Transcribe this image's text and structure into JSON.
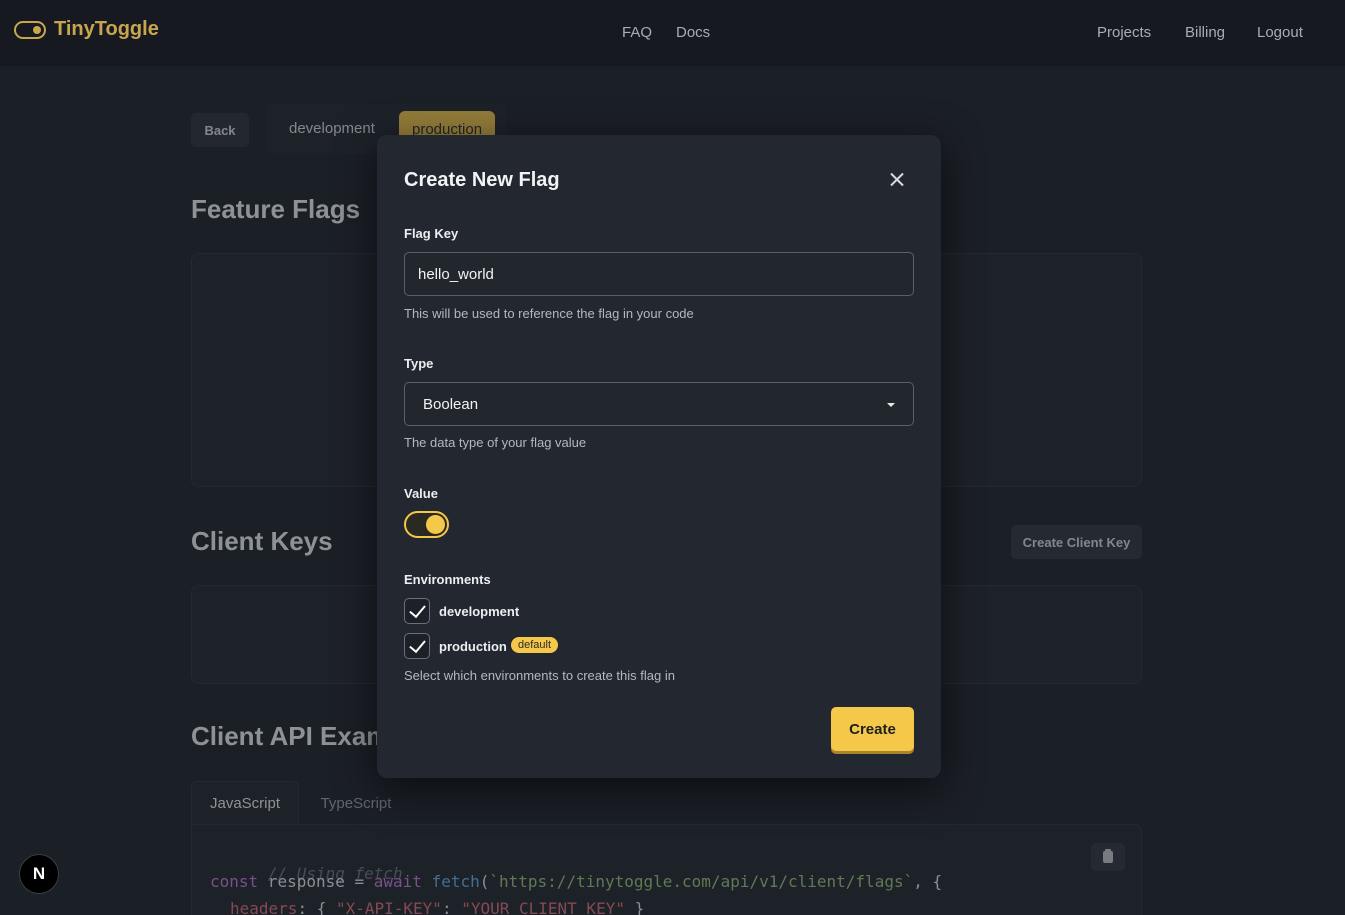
{
  "navbar": {
    "brand": "TinyToggle",
    "links_center": [
      "FAQ",
      "Docs"
    ],
    "links_right": [
      "Projects",
      "Billing",
      "Logout"
    ]
  },
  "page": {
    "back_label": "Back",
    "env_tabs": [
      "development",
      "production"
    ],
    "active_env": "production",
    "feature_flags_title": "Feature Flags",
    "client_keys_title": "Client Keys",
    "create_client_key_label": "Create Client Key",
    "client_api_title": "Client API Examples",
    "code_tabs": [
      "JavaScript",
      "TypeScript"
    ],
    "code": {
      "comment": "// Using fetch",
      "line2_kw1": "const",
      "line2_id": " response = ",
      "line2_kw2": "await",
      "line2_fn": " fetch",
      "line2_paren": "(",
      "line2_str": "`https://tinytoggle.com/api/v1/client/flags`",
      "line2_end": ", {",
      "line3_key": "headers",
      "line3_mid": ": { ",
      "line3_str1": "\"X-API-KEY\"",
      "line3_colon": ": ",
      "line3_str2": "\"YOUR_CLIENT_KEY\"",
      "line3_end": " }"
    }
  },
  "modal": {
    "title": "Create New Flag",
    "flag_key_label": "Flag Key",
    "flag_key_value": "hello_world",
    "flag_key_helper": "This will be used to reference the flag in your code",
    "type_label": "Type",
    "type_value": "Boolean",
    "type_helper": "The data type of your flag value",
    "value_label": "Value",
    "value_on": true,
    "environments_label": "Environments",
    "environments": [
      {
        "name": "development",
        "checked": true
      },
      {
        "name": "production",
        "checked": true
      }
    ],
    "default_badge": "default",
    "environments_helper": "Select which environments to create this flag in",
    "create_label": "Create"
  },
  "next_badge": "N"
}
